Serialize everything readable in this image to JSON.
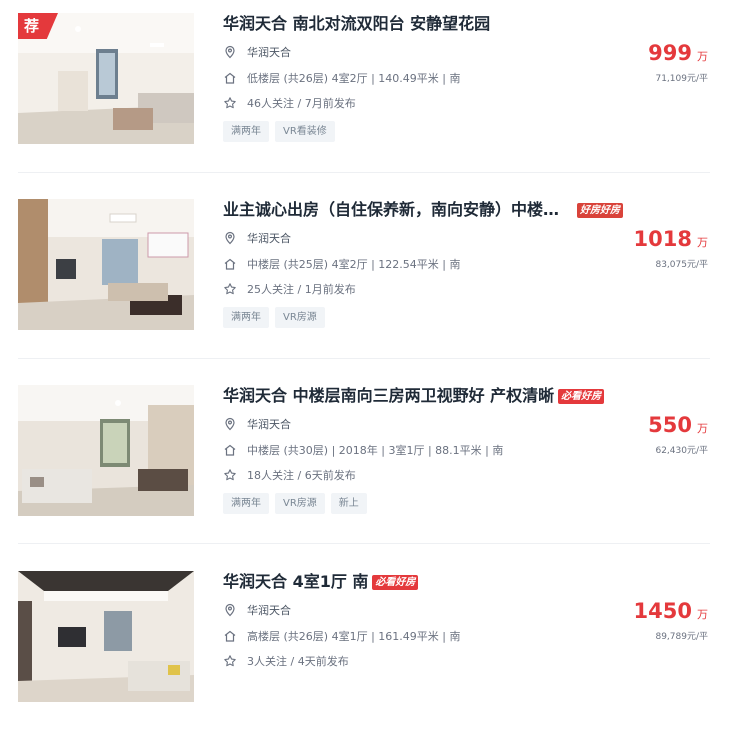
{
  "listings": [
    {
      "recommended_badge": "荐",
      "title": "华润天合 南北对流双阳台 安静望花园",
      "badge": "",
      "community": "华润天合",
      "house_info": "低楼层 (共26层) 4室2厅 | 140.49平米 | 南",
      "follow_info": "46人关注 / 7月前发布",
      "tags": [
        "满两年",
        "VR看装修"
      ],
      "price": "999",
      "price_unit": "万",
      "unit_price": "71,109元/平"
    },
    {
      "recommended_badge": "",
      "title": "业主诚心出房（自住保养新，南向安静）中楼层...",
      "badge": "好房好房",
      "community": "华润天合",
      "house_info": "中楼层 (共25层) 4室2厅 | 122.54平米 | 南",
      "follow_info": "25人关注 / 1月前发布",
      "tags": [
        "满两年",
        "VR房源"
      ],
      "price": "1018",
      "price_unit": "万",
      "unit_price": "83,075元/平"
    },
    {
      "recommended_badge": "",
      "title": "华润天合 中楼层南向三房两卫视野好 产权清晰",
      "badge": "必看好房",
      "community": "华润天合",
      "house_info": "中楼层 (共30层) | 2018年 | 3室1厅 | 88.1平米 | 南",
      "follow_info": "18人关注 / 6天前发布",
      "tags": [
        "满两年",
        "VR房源",
        "新上"
      ],
      "price": "550",
      "price_unit": "万",
      "unit_price": "62,430元/平"
    },
    {
      "recommended_badge": "",
      "title": "华润天合 4室1厅 南",
      "badge": "必看好房",
      "community": "华润天合",
      "house_info": "高楼层 (共26层) 4室1厅 | 161.49平米 | 南",
      "follow_info": "3人关注 / 4天前发布",
      "tags": [],
      "price": "1450",
      "price_unit": "万",
      "unit_price": "89,789元/平"
    }
  ],
  "icons": {
    "community": "location-pin-icon",
    "house": "house-icon",
    "follow": "star-icon"
  },
  "colors": {
    "price_red": "#e4393c",
    "title": "#1f2a37",
    "tag_bg": "#f1f4f7"
  }
}
